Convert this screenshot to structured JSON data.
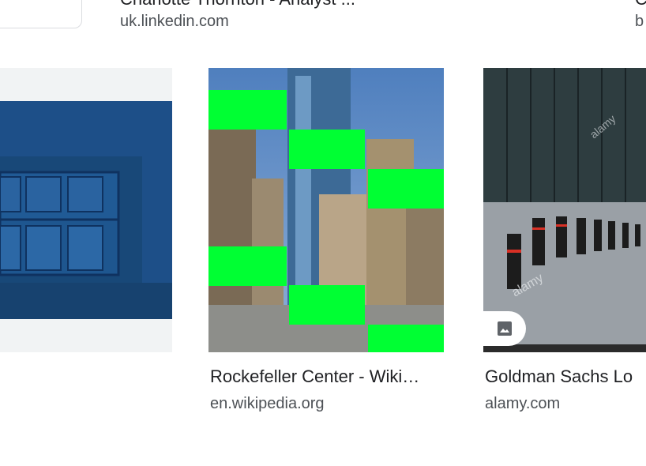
{
  "top_row": {
    "title_partial": "Charlotte Thornton - Analyst ...",
    "source": "uk.linkedin.com",
    "title_right_partial": "C",
    "source_right_partial": "b"
  },
  "results": [
    {
      "title": "",
      "source": ""
    },
    {
      "title": "Rockefeller Center - Wiki…",
      "source": "en.wikipedia.org"
    },
    {
      "title": "Goldman Sachs Lo",
      "source": "alamy.com",
      "watermark": "alamy"
    }
  ],
  "icons": {
    "image_badge": "image-icon"
  },
  "colors": {
    "text_primary": "#202124",
    "text_secondary": "#4d5156",
    "green_overlay": "#00ff33",
    "blue_photo": "#1c4f86"
  }
}
